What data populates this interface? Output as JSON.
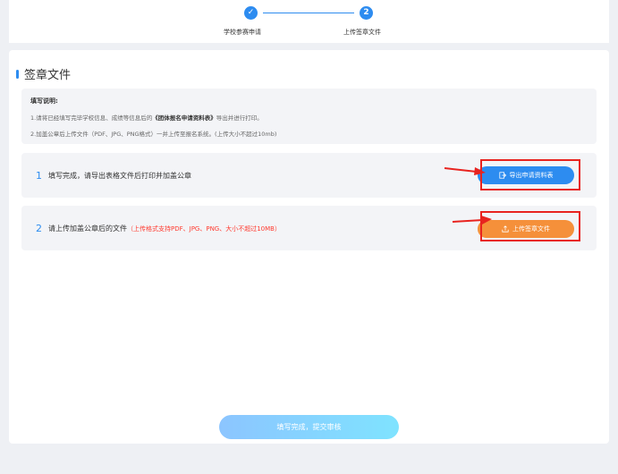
{
  "steps": [
    {
      "index": "✓",
      "label": "学校参赛申请"
    },
    {
      "index": "2",
      "label": "上传签章文件"
    }
  ],
  "section": {
    "title": "签章文件"
  },
  "notice": {
    "title": "填写说明:",
    "line1_prefix": "1.请将已经填写完毕学校信息、成绩等信息后的",
    "line1_bold": "《团体报名申请资料表》",
    "line1_suffix": "导出并进行打印。",
    "line2": "2.加盖公章后上传文件（PDF、JPG、PNG格式）一并上传至报名系统。(上传大小不超过10mb)"
  },
  "rows": [
    {
      "num": "1",
      "text": "填写完成，请导出表格文件后打印并加盖公章",
      "button": "导出申请资料表"
    },
    {
      "num": "2",
      "text": "请上传加盖公章后的文件",
      "hint": "（上传格式支持PDF、JPG、PNG、大小不超过10MB）",
      "button": "上传签章文件"
    }
  ],
  "submit": {
    "label": "填写完成，提交审核"
  },
  "colors": {
    "primary": "#2d8cf0",
    "upload": "#f5903a",
    "highlight": "#e8231f"
  }
}
